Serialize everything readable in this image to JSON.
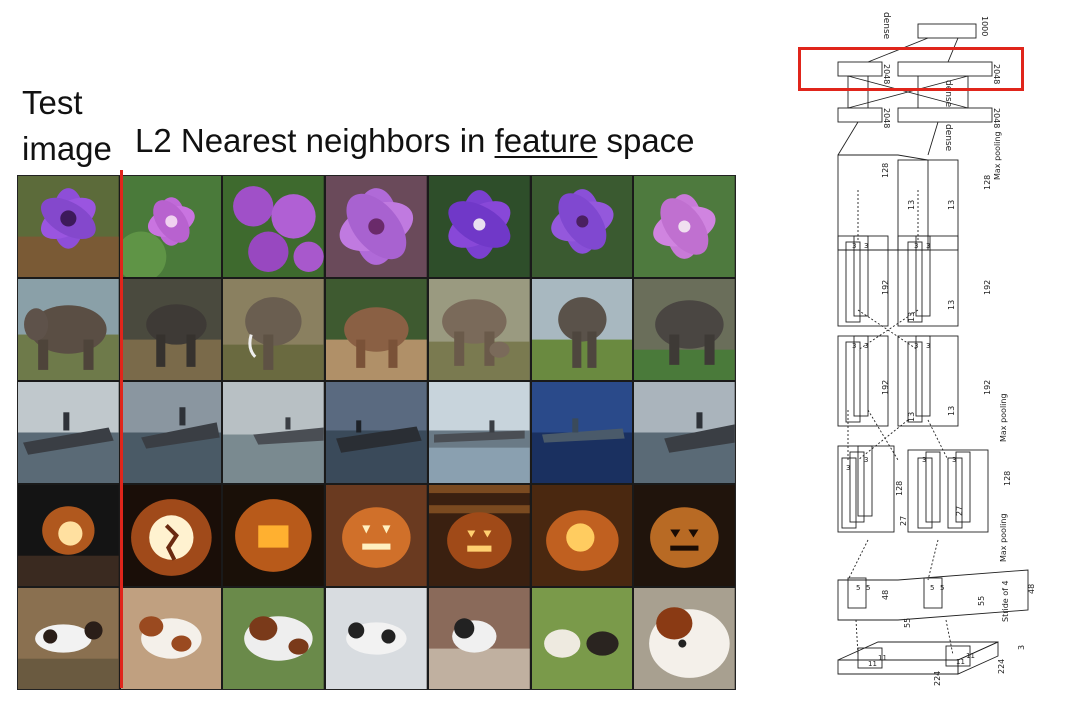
{
  "slide": {
    "test_label_line1": "Test",
    "test_label_line2": "image",
    "title_prefix": "L2 Nearest neighbors in ",
    "title_underlined": "feature",
    "title_suffix": " space"
  },
  "grid": {
    "rows": [
      {
        "subject": "purple-flower"
      },
      {
        "subject": "elephant"
      },
      {
        "subject": "aircraft-carrier"
      },
      {
        "subject": "jack-o-lantern"
      },
      {
        "subject": "dog"
      }
    ],
    "divider_color": "#e0251b"
  },
  "network": {
    "labels": {
      "dense_top": "dense",
      "out_1000": "1000",
      "fc_2048_a": "2048",
      "fc_2048_b": "2048",
      "fc_2048_c": "2048",
      "fc_2048_d": "2048",
      "dense_mid": "dense",
      "dense_low": "dense",
      "c5_128": "128",
      "c5_13a": "13",
      "c5_13b": "13",
      "c5_128b": "128",
      "maxpool_1": "Max pooling",
      "c4_3a": "3",
      "c4_3b": "3",
      "c4_3c": "3",
      "c4_3d": "3",
      "c4_192a": "192",
      "c4_192b": "192",
      "c4_13a": "13",
      "c4_13b": "13",
      "c3_3a": "3",
      "c3_3b": "3",
      "c3_3c": "3",
      "c3_3d": "3",
      "c3_192a": "192",
      "c3_192b": "192",
      "c3_13a": "13",
      "c3_13b": "13",
      "maxpool_2": "Max pooling",
      "c2_3a": "3",
      "c2_3b": "3",
      "c2_3c": "3",
      "c2_3d": "3",
      "c2_128a": "128",
      "c2_128b": "128",
      "c2_27a": "27",
      "c2_27b": "27",
      "maxpool_3": "Max pooling",
      "c1_5a": "5",
      "c1_5b": "5",
      "c1_5c": "5",
      "c1_5d": "5",
      "c1_48a": "48",
      "c1_48b": "48",
      "c1_55a": "55",
      "c1_55b": "55",
      "stride": "Stride of 4",
      "in_11a": "11",
      "in_11b": "11",
      "in_11c": "11",
      "in_11d": "11",
      "in_224a": "224",
      "in_224b": "224",
      "in_3": "3"
    },
    "highlight_color": "#e0251b"
  }
}
